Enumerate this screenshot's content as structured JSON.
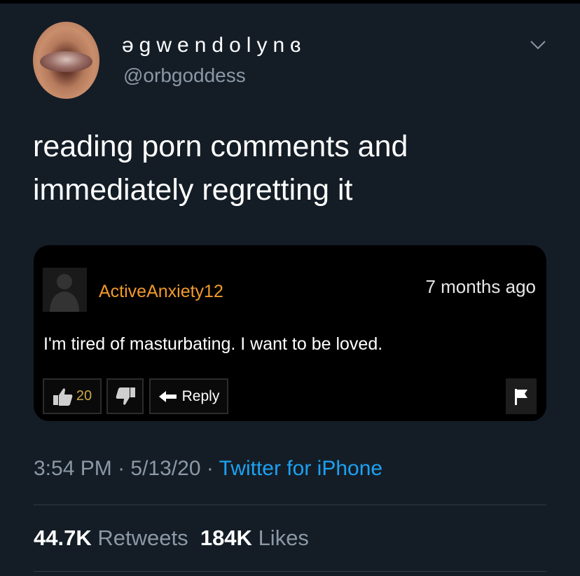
{
  "author": {
    "display_name": "əgwendolynɞ",
    "handle": "@orbgoddess"
  },
  "tweet": {
    "text_line1": "reading porn comments and",
    "text_line2": "immediately regretting it"
  },
  "embedded_comment": {
    "username": "ActiveAnxiety12",
    "time_ago": "7 months ago",
    "text": "I'm tired of masturbating. I want to be loved.",
    "like_count": "20",
    "reply_label": "Reply",
    "username_color": "#f19a2b"
  },
  "meta": {
    "time": "3:54 PM",
    "sep1": " · ",
    "date": "5/13/20",
    "sep2": " · ",
    "source": "Twitter for iPhone"
  },
  "stats": {
    "retweets_count": "44.7K",
    "retweets_label": "Retweets",
    "likes_count": "184K",
    "likes_label": "Likes"
  },
  "icons": [
    "chevron-down-icon",
    "thumbs-up-icon",
    "thumbs-down-icon",
    "reply-arrow-icon",
    "flag-icon",
    "user-silhouette-icon"
  ],
  "colors": {
    "background": "#141d26",
    "link": "#1da1f2",
    "secondary_text": "#8b98a5"
  }
}
